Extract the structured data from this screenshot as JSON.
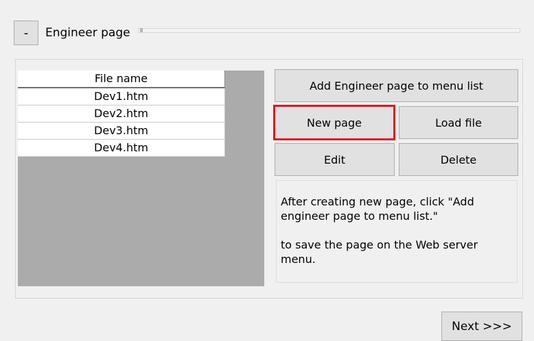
{
  "header": {
    "collapse_label": "-",
    "title": "Engineer page"
  },
  "file_list": {
    "column_header": "File name",
    "rows": [
      "Dev1.htm",
      "Dev2.htm",
      "Dev3.htm",
      "Dev4.htm"
    ]
  },
  "buttons": {
    "add_to_menu": "Add Engineer page to menu list",
    "new_page": "New page",
    "load_file": "Load file",
    "edit": "Edit",
    "delete": "Delete",
    "next": "Next >>>"
  },
  "info": {
    "line1": "After creating new page, click \"Add engineer page to menu list.\"",
    "line2": "to save the page on the Web server menu."
  },
  "colors": {
    "highlight": "#e8101a",
    "list_background": "#ababab",
    "button_face": "#e1e1e1"
  }
}
